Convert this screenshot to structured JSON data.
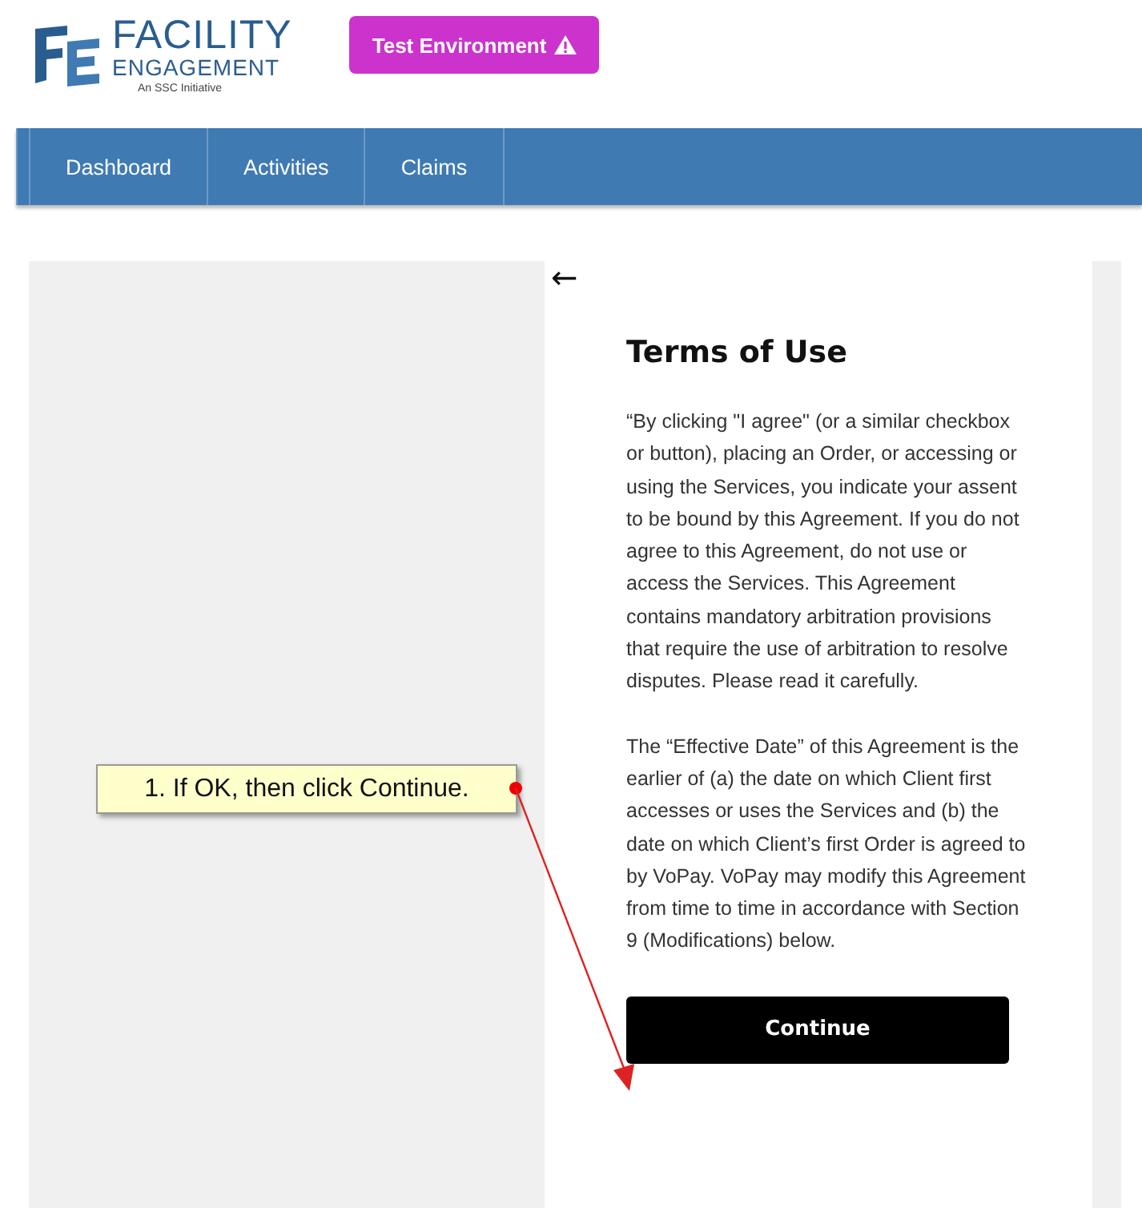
{
  "logo": {
    "title": "FACILITY",
    "subtitle": "ENGAGEMENT",
    "tagline": "An SSC Initiative"
  },
  "environment_badge": {
    "label": "Test Environment"
  },
  "nav": [
    {
      "label": "Dashboard"
    },
    {
      "label": "Activities"
    },
    {
      "label": "Claims"
    }
  ],
  "back": {
    "label": "←"
  },
  "terms": {
    "title": "Terms of Use",
    "paragraphs": [
      "“By clicking \"I agree\" (or a similar checkbox or button), placing an Order, or accessing or using the Services, you indicate your assent to be bound by this Agreement. If you do not agree to this Agreement, do not use or access the Services. This Agreement contains mandatory arbitration provisions that require the use of arbitration to resolve disputes. Please read it carefully.",
      "The “Effective Date” of this Agreement is the earlier of (a) the date on which Client first accesses or uses the Services and (b) the date on which Client’s first Order is agreed to by VoPay. VoPay may modify this Agreement from time to time in accordance with Section 9 (Modifications) below."
    ],
    "button": "Continue"
  },
  "callout": {
    "text": "1. If OK, then click Continue."
  }
}
